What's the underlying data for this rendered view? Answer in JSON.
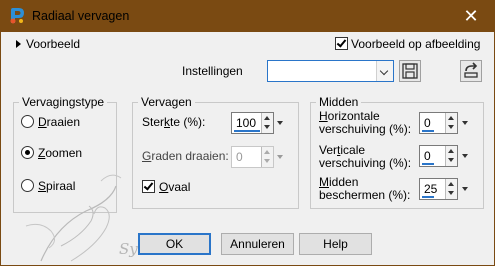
{
  "window": {
    "title": "Radiaal vervagen",
    "close_glyph": "✕"
  },
  "preview": {
    "toggle_label": "Voorbeeld",
    "checkbox_label": "Voorbeeld op afbeelding",
    "checked": true
  },
  "settings": {
    "label": "Instellingen",
    "value": ""
  },
  "blur_type": {
    "title": "Vervagingstype",
    "options": [
      {
        "pre": "",
        "acc": "D",
        "post": "raaien",
        "selected": false
      },
      {
        "pre": "",
        "acc": "Z",
        "post": "oomen",
        "selected": true
      },
      {
        "pre": "",
        "acc": "S",
        "post": "piraal",
        "selected": false
      }
    ]
  },
  "blur": {
    "title": "Vervagen",
    "strength": {
      "pre": "Ster",
      "acc": "k",
      "post": "te (%):",
      "value": "100"
    },
    "twist": {
      "pre": "",
      "acc": "G",
      "post": "raden draaien:",
      "value": "0",
      "disabled": true
    },
    "ellipse": {
      "pre": "",
      "acc": "O",
      "post": "vaal",
      "checked": true
    }
  },
  "center": {
    "title": "Midden",
    "horizontal": {
      "line1_pre": "",
      "line1_acc": "H",
      "line1_post": "orizontale",
      "line2": "verschuiving (%):",
      "value": "0"
    },
    "vertical": {
      "line1_pre": "Ver",
      "line1_acc": "t",
      "line1_post": "icale",
      "line2": "verschuiving (%):",
      "value": "0"
    },
    "protect": {
      "line1_pre": "",
      "line1_acc": "M",
      "line1_post": "idden",
      "line2": "beschermen (%):",
      "value": "25"
    }
  },
  "buttons": {
    "ok": "OK",
    "cancel": "Annuleren",
    "help": "Help"
  },
  "watermark": {
    "text": "Sylviane"
  },
  "colors": {
    "titlebar": "#7a4a12",
    "accent": "#2a75c9",
    "dialog_bg": "#f0f0f0"
  }
}
